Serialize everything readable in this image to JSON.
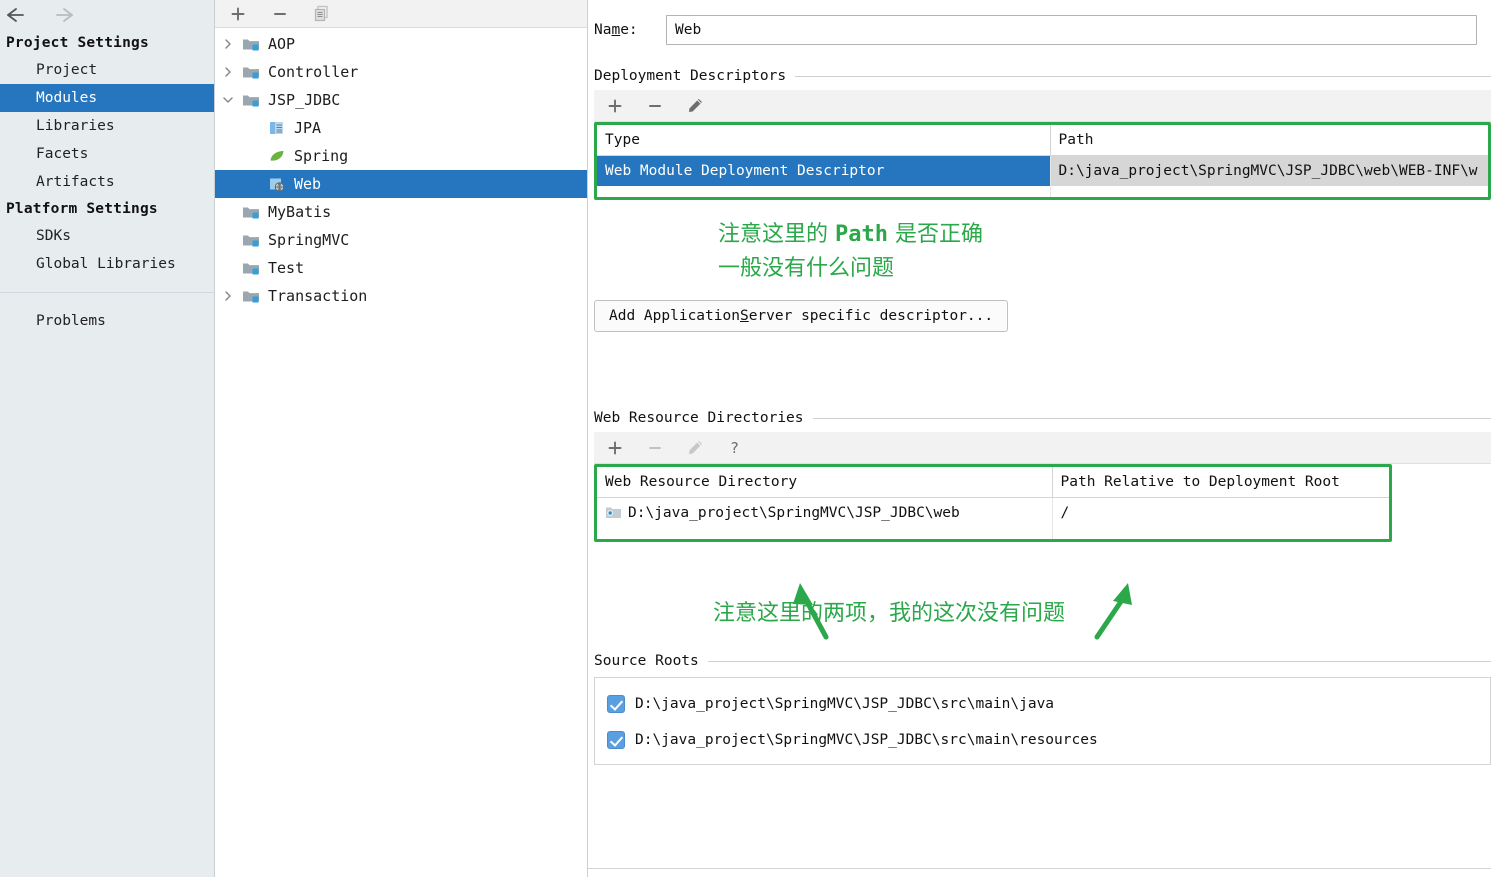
{
  "window": {
    "nav": {
      "back": "back-arrow",
      "forward": "forward-arrow"
    }
  },
  "sidebar": {
    "groups": [
      {
        "title": "Project Settings",
        "items": [
          {
            "label": "Project",
            "selected": false
          },
          {
            "label": "Modules",
            "selected": true
          },
          {
            "label": "Libraries",
            "selected": false
          },
          {
            "label": "Facets",
            "selected": false
          },
          {
            "label": "Artifacts",
            "selected": false
          }
        ]
      },
      {
        "title": "Platform Settings",
        "items": [
          {
            "label": "SDKs",
            "selected": false
          },
          {
            "label": "Global Libraries",
            "selected": false
          }
        ]
      }
    ],
    "problems_label": "Problems"
  },
  "tree": {
    "toolbar": [
      {
        "name": "add-module-button",
        "glyph": "plus"
      },
      {
        "name": "remove-module-button",
        "glyph": "minus"
      },
      {
        "name": "copy-module-button",
        "glyph": "copy"
      }
    ],
    "nodes": [
      {
        "label": "AOP",
        "indent": 0,
        "twisty": "collapsed",
        "icon": "module-folder",
        "selected": false
      },
      {
        "label": "Controller",
        "indent": 0,
        "twisty": "collapsed",
        "icon": "module-folder",
        "selected": false
      },
      {
        "label": "JSP_JDBC",
        "indent": 0,
        "twisty": "expanded",
        "icon": "module-folder",
        "selected": false
      },
      {
        "label": "JPA",
        "indent": 1,
        "twisty": "none",
        "icon": "jpa-facet",
        "selected": false
      },
      {
        "label": "Spring",
        "indent": 1,
        "twisty": "none",
        "icon": "spring-facet",
        "selected": false
      },
      {
        "label": "Web",
        "indent": 1,
        "twisty": "none",
        "icon": "web-facet",
        "selected": true
      },
      {
        "label": "MyBatis",
        "indent": 0,
        "twisty": "none",
        "icon": "module-folder",
        "selected": false
      },
      {
        "label": "SpringMVC",
        "indent": 0,
        "twisty": "none",
        "icon": "module-folder",
        "selected": false
      },
      {
        "label": "Test",
        "indent": 0,
        "twisty": "none",
        "icon": "module-folder",
        "selected": false
      },
      {
        "label": "Transaction",
        "indent": 0,
        "twisty": "collapsed",
        "icon": "module-folder",
        "selected": false
      }
    ]
  },
  "detail": {
    "name_label": "Name:",
    "name_value": "Web",
    "deployment_descriptors": {
      "section_title": "Deployment Descriptors",
      "toolbar": [
        {
          "name": "add-descriptor-button",
          "glyph": "plus",
          "enabled": true
        },
        {
          "name": "remove-descriptor-button",
          "glyph": "minus",
          "enabled": true
        },
        {
          "name": "edit-descriptor-button",
          "glyph": "pencil",
          "enabled": true
        }
      ],
      "columns": [
        "Type",
        "Path"
      ],
      "rows": [
        {
          "type": "Web Module Deployment Descriptor",
          "path": "D:\\java_project\\SpringMVC\\JSP_JDBC\\web\\WEB-INF\\w",
          "selected": true
        }
      ],
      "add_server_descriptor_button": {
        "prefix": "Add Application ",
        "mnemonic": "S",
        "suffix": "erver specific descriptor..."
      }
    },
    "web_resource_directories": {
      "section_title": "Web Resource Directories",
      "toolbar": [
        {
          "name": "add-web-resource-button",
          "glyph": "plus",
          "enabled": true
        },
        {
          "name": "remove-web-resource-button",
          "glyph": "minus",
          "enabled": false
        },
        {
          "name": "edit-web-resource-button",
          "glyph": "pencil",
          "enabled": false
        },
        {
          "name": "web-resource-help-button",
          "glyph": "question",
          "enabled": true
        }
      ],
      "columns": [
        "Web Resource Directory",
        "Path Relative to Deployment Root"
      ],
      "rows": [
        {
          "directory": "D:\\java_project\\SpringMVC\\JSP_JDBC\\web",
          "relative_path": "/"
        }
      ]
    },
    "source_roots": {
      "section_title": "Source Roots",
      "rows": [
        {
          "checked": true,
          "path": "D:\\java_project\\SpringMVC\\JSP_JDBC\\src\\main\\java"
        },
        {
          "checked": true,
          "path": "D:\\java_project\\SpringMVC\\JSP_JDBC\\src\\main\\resources"
        }
      ]
    }
  },
  "annotations": {
    "color": "#2aa84a",
    "path_note": {
      "line1_pre": "注意这里的 ",
      "line1_mono": "Path",
      "line1_post": " 是否正确",
      "line2": "一般没有什么问题"
    },
    "web_resource_note": {
      "line1": "注意这里的两项，我的这次没有问题"
    }
  },
  "colors": {
    "selection_blue": "#2675bf",
    "annotation_green": "#2aa84a",
    "sidebar_bg": "#e7ecef",
    "toolbar_bg": "#f2f2f2"
  }
}
